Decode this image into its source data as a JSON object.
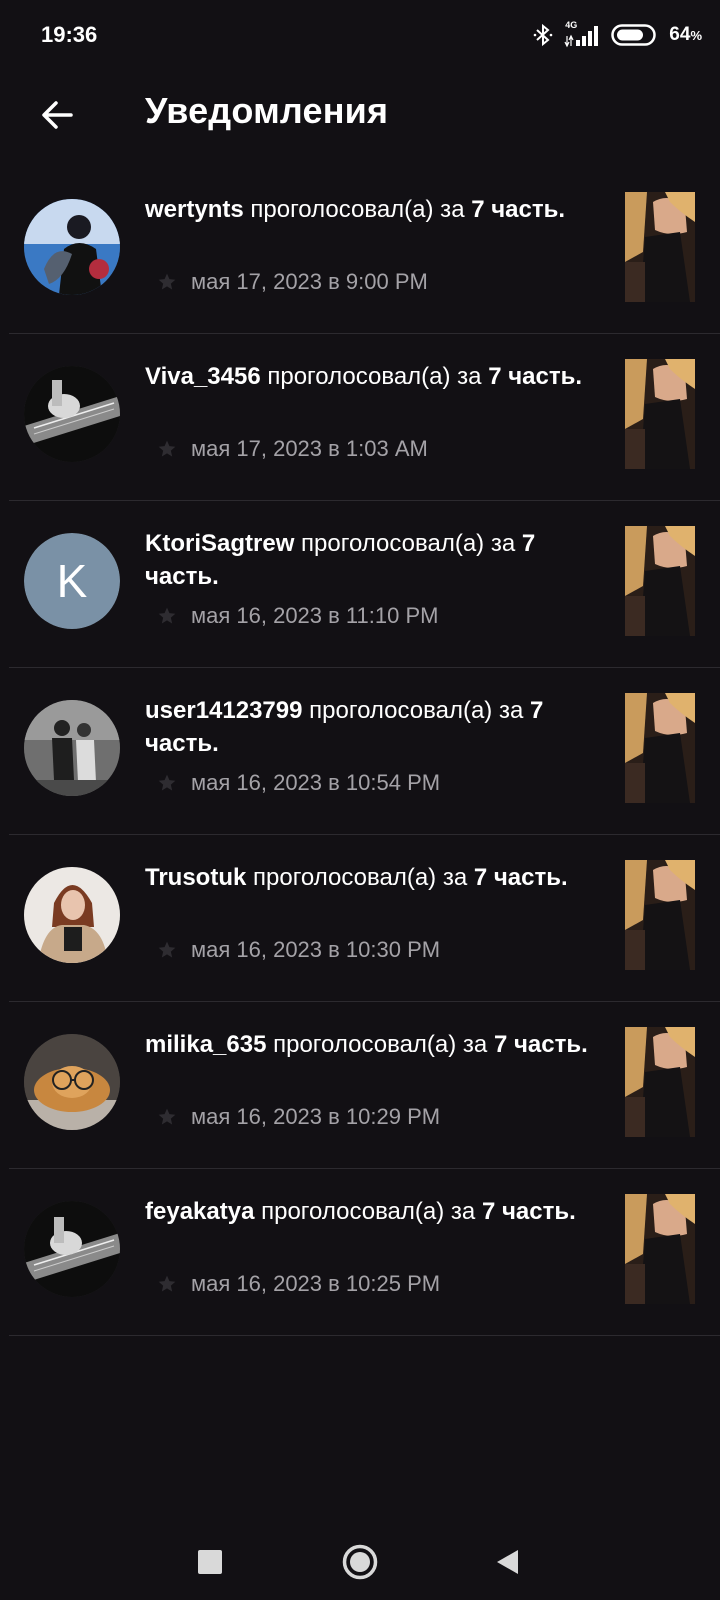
{
  "status_bar": {
    "time": "19:36",
    "network": "4G",
    "battery_percent": "64",
    "battery_unit": "%"
  },
  "header": {
    "title": "Уведомления",
    "back_icon": "arrow-left-icon"
  },
  "notifications": [
    {
      "username": "wertynts",
      "action": "проголосовал(а) за",
      "part": "7 часть.",
      "date": "мая 17, 2023 в 9:00 PM",
      "avatar": "photo"
    },
    {
      "username": "Viva_3456",
      "action": "проголосовал(а) за",
      "part": "7 часть.",
      "date": "мая 17, 2023 в 1:03 AM",
      "avatar": "photo"
    },
    {
      "username": "KtoriSagtrew",
      "action": "проголосовал(а) за",
      "part": "7 часть.",
      "date": "мая 16, 2023 в 11:10 PM",
      "avatar_letter": "K"
    },
    {
      "username": "user14123799",
      "action": "проголосовал(а) за",
      "part": "7 часть.",
      "date": "мая 16, 2023 в 10:54 PM",
      "avatar": "photo"
    },
    {
      "username": "Trusotuk",
      "action": "проголосовал(а) за",
      "part": "7 часть.",
      "date": "мая 16, 2023 в 10:30 PM",
      "avatar": "photo"
    },
    {
      "username": "milika_635",
      "action": "проголосовал(а) за",
      "part": "7 часть.",
      "date": "мая 16, 2023 в 10:29 PM",
      "avatar": "photo"
    },
    {
      "username": "feyakatya",
      "action": "проголосовал(а) за",
      "part": "7 часть.",
      "date": "мая 16, 2023 в 10:25 PM",
      "avatar": "photo"
    }
  ],
  "nav_bar": {
    "recents_icon": "square-icon",
    "home_icon": "circle-icon",
    "back_icon": "triangle-back-icon"
  },
  "colors": {
    "background": "#121014",
    "text_primary": "#ffffff",
    "text_secondary": "#a4a2a7",
    "divider": "#2c2a2f",
    "letter_avatar": "#7a91a6"
  }
}
